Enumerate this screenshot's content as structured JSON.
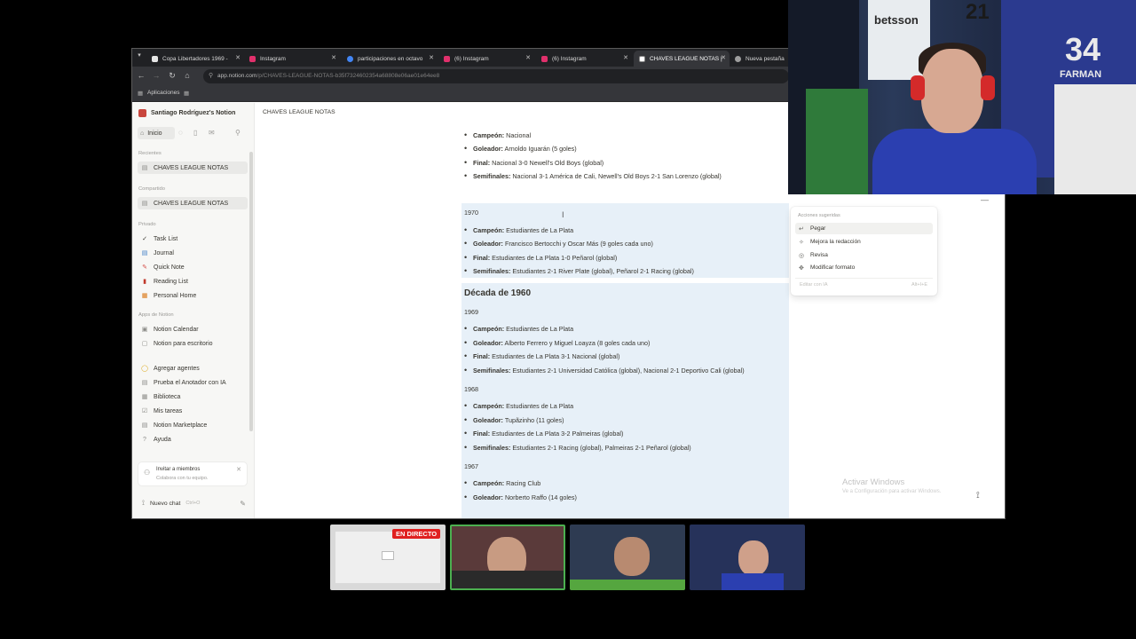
{
  "browser": {
    "tabs": [
      {
        "label": "Copa Libertadores 1969 -",
        "icon": "globe",
        "color": "#e6e6e6"
      },
      {
        "label": "Instagram",
        "icon": "instagram",
        "color": "#e1306c"
      },
      {
        "label": "participaciones en octavo",
        "icon": "google",
        "color": "#4285f4"
      },
      {
        "label": "(6) Instagram",
        "icon": "instagram",
        "color": "#e1306c"
      },
      {
        "label": "(6) Instagram",
        "icon": "instagram",
        "color": "#e1306c"
      },
      {
        "label": "CHAVES LEAGUE NOTAS |",
        "icon": "notion",
        "color": "#ffffff"
      },
      {
        "label": "Nueva pestaña",
        "icon": "chrome",
        "color": "#9e9e9e"
      }
    ],
    "url": "app.notion.com",
    "url_path": "/p/CHAVES-LEAGUE-NOTAS-b35f7324602354a68808e06ae01e64ee8",
    "bookmarks_label": "Aplicaciones"
  },
  "sidebar": {
    "workspace": "Santiago Rodríguez's Notion",
    "home": "Inicio",
    "recent_header": "Recientes",
    "recent": [
      "CHAVES LEAGUE NOTAS"
    ],
    "shared_header": "Compartido",
    "shared": [
      "CHAVES LEAGUE NOTAS"
    ],
    "private_header": "Privado",
    "private": [
      {
        "label": "Task List",
        "icon": "✓"
      },
      {
        "label": "Journal",
        "icon": "▤"
      },
      {
        "label": "Quick Note",
        "icon": "✎"
      },
      {
        "label": "Reading List",
        "icon": "▮"
      },
      {
        "label": "Personal Home",
        "icon": "▦"
      }
    ],
    "apps_header": "Apps de Notion",
    "apps": [
      {
        "label": "Notion Calendar",
        "icon": "▣"
      },
      {
        "label": "Notion para escritorio",
        "icon": "▢"
      }
    ],
    "tools": [
      {
        "label": "Agregar agentes",
        "icon": "◯"
      },
      {
        "label": "Prueba el Anotador con IA",
        "icon": "▤"
      },
      {
        "label": "Biblioteca",
        "icon": "▦"
      },
      {
        "label": "Mis tareas",
        "icon": "☑"
      },
      {
        "label": "Notion Marketplace",
        "icon": "▤"
      },
      {
        "label": "Ayuda",
        "icon": "?"
      }
    ],
    "invite_title": "Invitar a miembros",
    "invite_sub": "Colabora con tu equipo.",
    "new_chat": "Nuevo chat",
    "new_chat_kbd": "Ctrl+O"
  },
  "page": {
    "breadcrumb": "CHAVES LEAGUE NOTAS",
    "top_block": [
      {
        "k": "Campeón:",
        "v": " Nacional"
      },
      {
        "k": "Goleador:",
        "v": " Arnoldo Iguarán (5 goles)"
      },
      {
        "k": "Final:",
        "v": " Nacional 3-0 Newell's Old Boys (global)"
      },
      {
        "k": "Semifinales:",
        "v": " Nacional 3-1 América de Cali, Newell's Old Boys 2-1 San Lorenzo (global)"
      }
    ],
    "y1970": "1970",
    "b1970": [
      {
        "k": "Campeón:",
        "v": " Estudiantes de La Plata"
      },
      {
        "k": "Goleador:",
        "v": " Francisco Bertocchi y Oscar Más (9 goles cada uno)"
      },
      {
        "k": "Final:",
        "v": " Estudiantes de La Plata 1-0 Peñarol (global)"
      },
      {
        "k": "Semifinales:",
        "v": " Estudiantes 2-1 River Plate (global), Peñarol 2-1 Racing (global)"
      }
    ],
    "decade": "Década de 1960",
    "y1969": "1969",
    "b1969": [
      {
        "k": "Campeón:",
        "v": " Estudiantes de La Plata"
      },
      {
        "k": "Goleador:",
        "v": " Alberto Ferrero y Miguel Loayza (8 goles cada uno)"
      },
      {
        "k": "Final:",
        "v": " Estudiantes de La Plata 3-1 Nacional (global)"
      },
      {
        "k": "Semifinales:",
        "v": " Estudiantes 2-1 Universidad Católica (global), Nacional 2-1 Deportivo Cali (global)"
      }
    ],
    "y1968": "1968",
    "b1968": [
      {
        "k": "Campeón:",
        "v": " Estudiantes de La Plata"
      },
      {
        "k": "Goleador:",
        "v": " Tupãzinho (11 goles)"
      },
      {
        "k": "Final:",
        "v": " Estudiantes de La Plata 3-2 Palmeiras (global)"
      },
      {
        "k": "Semifinales:",
        "v": " Estudiantes 2-1 Racing (global), Palmeiras 2-1 Peñarol (global)"
      }
    ],
    "y1967": "1967",
    "b1967": [
      {
        "k": "Campeón:",
        "v": " Racing Club"
      },
      {
        "k": "Goleador:",
        "v": " Norberto Raffo (14 goles)"
      }
    ]
  },
  "ai_menu": {
    "header": "Acciones sugeridas",
    "items": [
      {
        "label": "Pegar",
        "icon": "↵"
      },
      {
        "label": "Mejora la redacción",
        "icon": "✧"
      },
      {
        "label": "Revisa",
        "icon": "◎"
      },
      {
        "label": "Modificar formato",
        "icon": "✥"
      }
    ],
    "input_placeholder": "Editar con IA",
    "input_kbd": "Alt+I+E"
  },
  "watermark": {
    "title": "Activar Windows",
    "sub": "Ve a Configuración para activar Windows."
  },
  "stream": {
    "live_badge": "EN DIRECTO",
    "cam_text_1": "betsson",
    "cam_text_2": "34",
    "cam_text_3": "FARMAN",
    "cam_text_4": "21"
  }
}
